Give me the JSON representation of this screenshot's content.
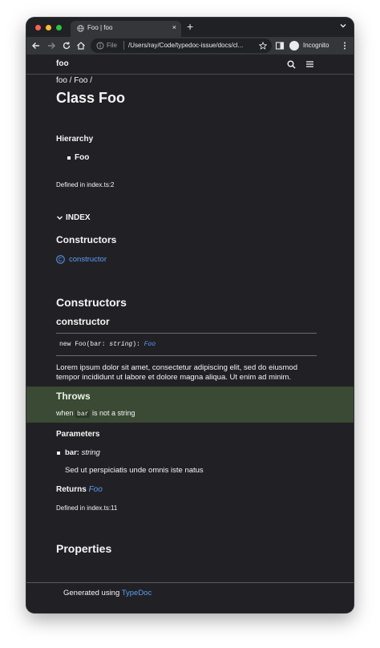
{
  "browser": {
    "tab_title": "Foo | foo",
    "new_tab": "+",
    "close_tab": "×",
    "scheme": "File",
    "url": "/Users/ray/Code/typedoc-issue/docs/cl...",
    "incognito_label": "Incognito"
  },
  "site": {
    "title": "foo"
  },
  "breadcrumb": {
    "part1": "foo",
    "sep1": " / ",
    "part2": "Foo",
    "sep2": " /"
  },
  "page_title": "Class Foo",
  "hierarchy": {
    "heading": "Hierarchy",
    "item": "Foo"
  },
  "defined_in_top": "Defined in index.ts:2",
  "index": {
    "label": "INDEX",
    "constructors_heading": "Constructors",
    "constructor_icon_letter": "C",
    "constructor_link": "constructor"
  },
  "constructors_section": {
    "heading": "Constructors",
    "member_name": "constructor",
    "signature": {
      "prefix": "new Foo(bar: ",
      "param_type": "string",
      "mid": "): ",
      "return_type": "Foo"
    },
    "description": "Lorem ipsum dolor sit amet, consectetur adipiscing elit, sed do eiusmod tempor incididunt ut labore et dolore magna aliqua. Ut enim ad minim.",
    "throws": {
      "heading": "Throws",
      "text_before": "when ",
      "code": "bar",
      "text_after": " is not a string"
    },
    "parameters": {
      "heading": "Parameters",
      "name": "bar:",
      "type": "string",
      "description": "Sed ut perspiciatis unde omnis iste natus"
    },
    "returns": {
      "label": "Returns",
      "type": "Foo"
    },
    "defined_in": "Defined in index.ts:11"
  },
  "properties_heading": "Properties",
  "footer": {
    "text": "Generated using ",
    "link": "TypeDoc"
  },
  "colors": {
    "page_bg": "#212125",
    "link": "#5c9cf5",
    "throws_bg": "#3a4a35"
  }
}
